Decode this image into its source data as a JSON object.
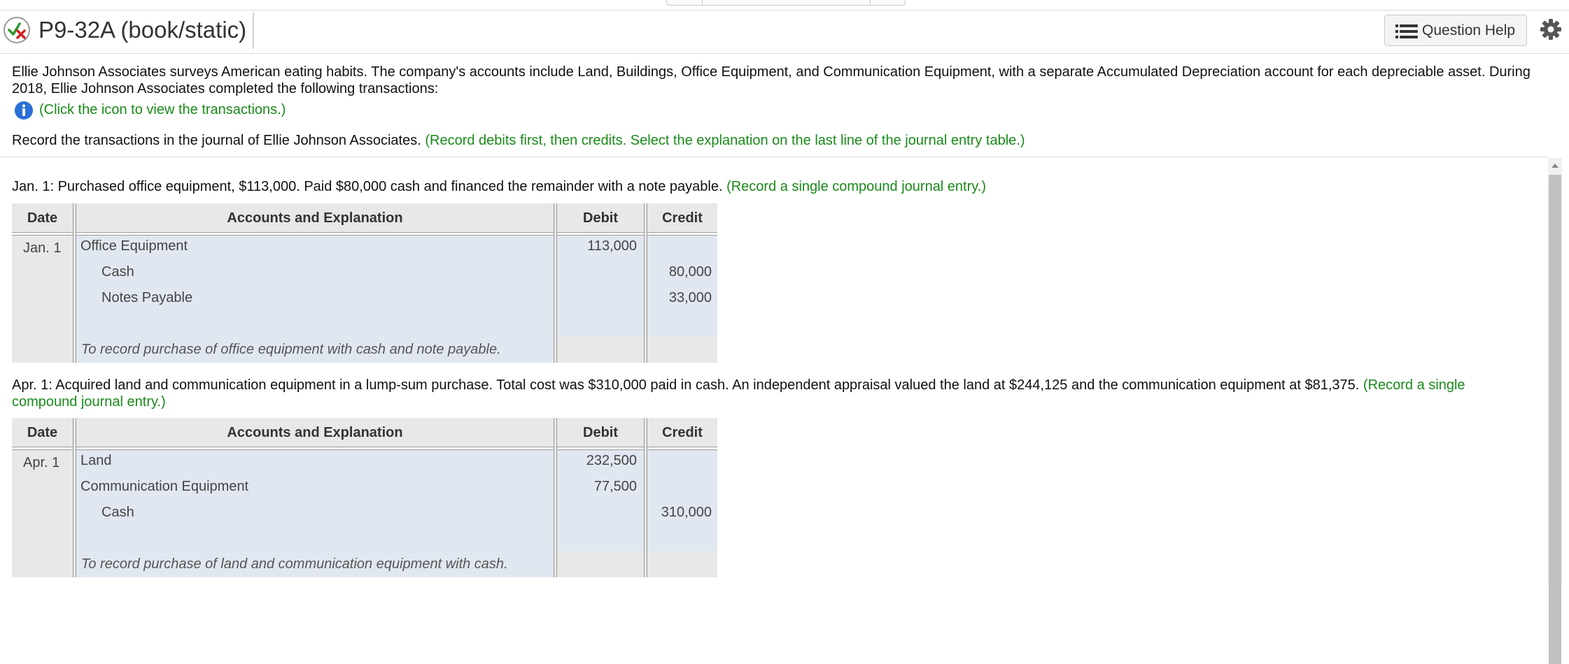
{
  "header": {
    "title": "P9-32A (book/static)",
    "question_help": "Question Help",
    "status_icon": "partial-correct-icon",
    "settings_icon": "gear-icon"
  },
  "intro": {
    "text": "Ellie Johnson Associates surveys American eating habits. The company's accounts include Land, Buildings, Office Equipment, and Communication Equipment, with a separate Accumulated Depreciation account for each depreciable asset. During 2018, Ellie Johnson Associates completed the following transactions:",
    "info_link": "(Click the icon to view the transactions.)"
  },
  "instruction": {
    "text": "Record the transactions in the journal of Ellie Johnson Associates. ",
    "hint": "(Record debits first, then credits. Select the explanation on the last line of the journal entry table.)"
  },
  "columns": {
    "date": "Date",
    "accounts": "Accounts and Explanation",
    "debit": "Debit",
    "credit": "Credit"
  },
  "entries": [
    {
      "description": "Jan. 1: Purchased office equipment, $113,000. Paid $80,000 cash and financed the remainder with a note payable. ",
      "hint": "(Record a single compound journal entry.)",
      "date": "Jan. 1",
      "lines": [
        {
          "account": "Office Equipment",
          "debit": "113,000",
          "credit": ""
        },
        {
          "account": "Cash",
          "debit": "",
          "credit": "80,000"
        },
        {
          "account": "Notes Payable",
          "debit": "",
          "credit": "33,000"
        }
      ],
      "explanation": "To record purchase of office equipment with cash and note payable."
    },
    {
      "description": "Apr. 1: Acquired land and communication equipment in a lump-sum purchase. Total cost was $310,000 paid in cash. An independent appraisal valued the land at $244,125 and the communication equipment at $81,375. ",
      "hint": "(Record a single compound journal entry.)",
      "date": "Apr. 1",
      "lines": [
        {
          "account": "Land",
          "debit": "232,500",
          "credit": ""
        },
        {
          "account": "Communication Equipment",
          "debit": "77,500",
          "credit": ""
        },
        {
          "account": "Cash",
          "debit": "",
          "credit": "310,000"
        }
      ],
      "explanation": "To record purchase of land and communication equipment with cash."
    }
  ]
}
